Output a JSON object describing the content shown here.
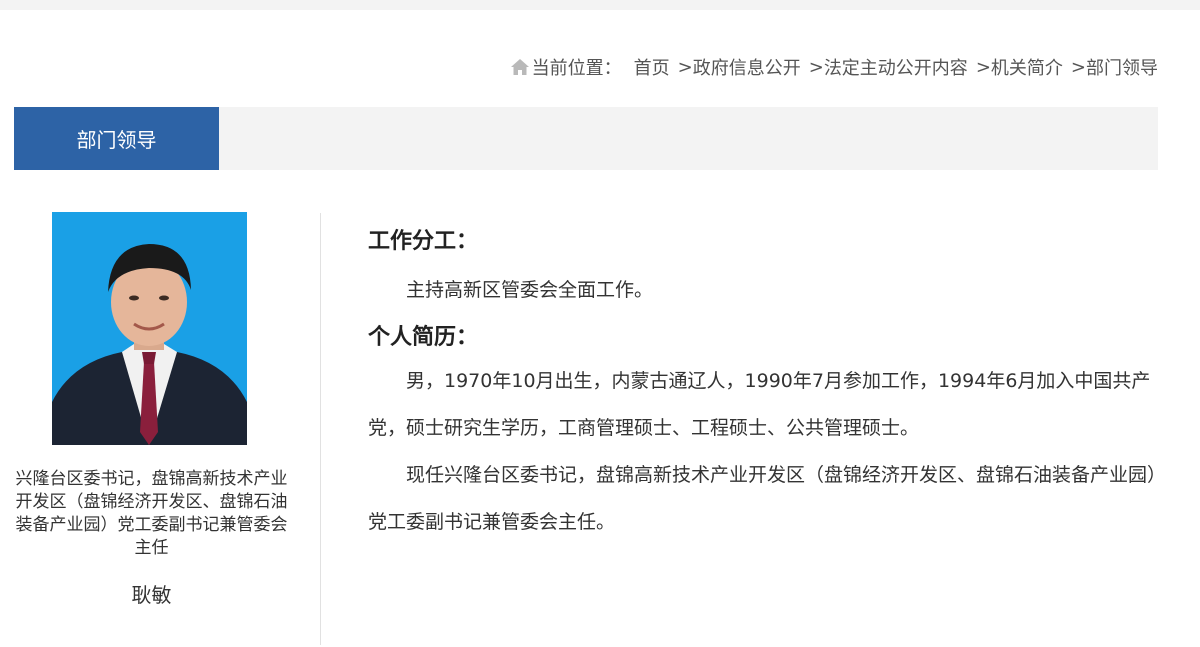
{
  "breadcrumb": {
    "prefix": "当前位置：",
    "items": [
      "首页",
      "政府信息公开",
      "法定主动公开内容",
      "机关简介",
      "部门领导"
    ],
    "separator": ">",
    "icon": "home-icon"
  },
  "section": {
    "title": "部门领导"
  },
  "leader": {
    "caption": "兴隆台区委书记，盘锦高新技术产业开发区（盘锦经济开发区、盘锦石油装备产业园）党工委副书记兼管委会主任",
    "name": "耿敏"
  },
  "content": {
    "duty_heading": "工作分工：",
    "duty_text": "主持高新区管委会全面工作。",
    "resume_heading": "个人简历：",
    "resume_paragraphs": [
      "男，1970年10月出生，内蒙古通辽人，1990年7月参加工作，1994年6月加入中国共产党，硕士研究生学历，工商管理硕士、工程硕士、公共管理硕士。",
      "现任兴隆台区委书记，盘锦高新技术产业开发区（盘锦经济开发区、盘锦石油装备产业园）党工委副书记兼管委会主任。"
    ]
  },
  "colors": {
    "accent": "#2d63a6",
    "bar_bg": "#f3f3f3",
    "photo_bg": "#1aa0e6"
  }
}
